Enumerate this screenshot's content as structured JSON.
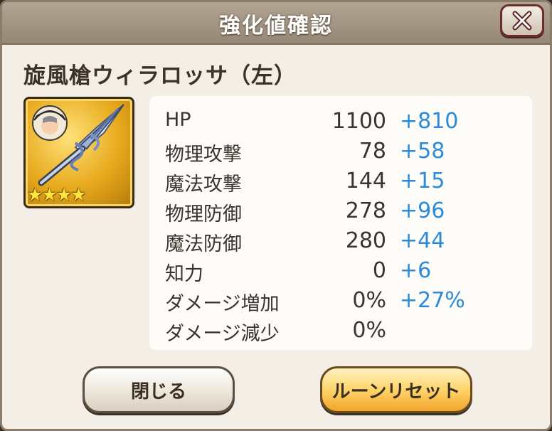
{
  "dialog": {
    "title": "強化値確認",
    "close_icon": "close-x-icon"
  },
  "item": {
    "name": "旋風槍ウィラロッサ（左）",
    "rarity_stars": 4,
    "stars_text": "★★★★",
    "icon": "spear-weapon-icon"
  },
  "stats": [
    {
      "label": "HP",
      "value": "1100",
      "bonus": "+810"
    },
    {
      "label": "物理攻撃",
      "value": "78",
      "bonus": "+58"
    },
    {
      "label": "魔法攻撃",
      "value": "144",
      "bonus": "+15"
    },
    {
      "label": "物理防御",
      "value": "278",
      "bonus": "+96"
    },
    {
      "label": "魔法防御",
      "value": "280",
      "bonus": "+44"
    },
    {
      "label": "知力",
      "value": "0",
      "bonus": "+6"
    },
    {
      "label": "ダメージ増加",
      "value": "0%",
      "bonus": "+27%"
    },
    {
      "label": "ダメージ減少",
      "value": "0%",
      "bonus": ""
    }
  ],
  "buttons": {
    "close_label": "閉じる",
    "reset_label": "ルーンリセット"
  },
  "colors": {
    "bonus": "#2d8ad8",
    "reset_button": "#ffd56a",
    "title_bar": "#a89a88"
  }
}
